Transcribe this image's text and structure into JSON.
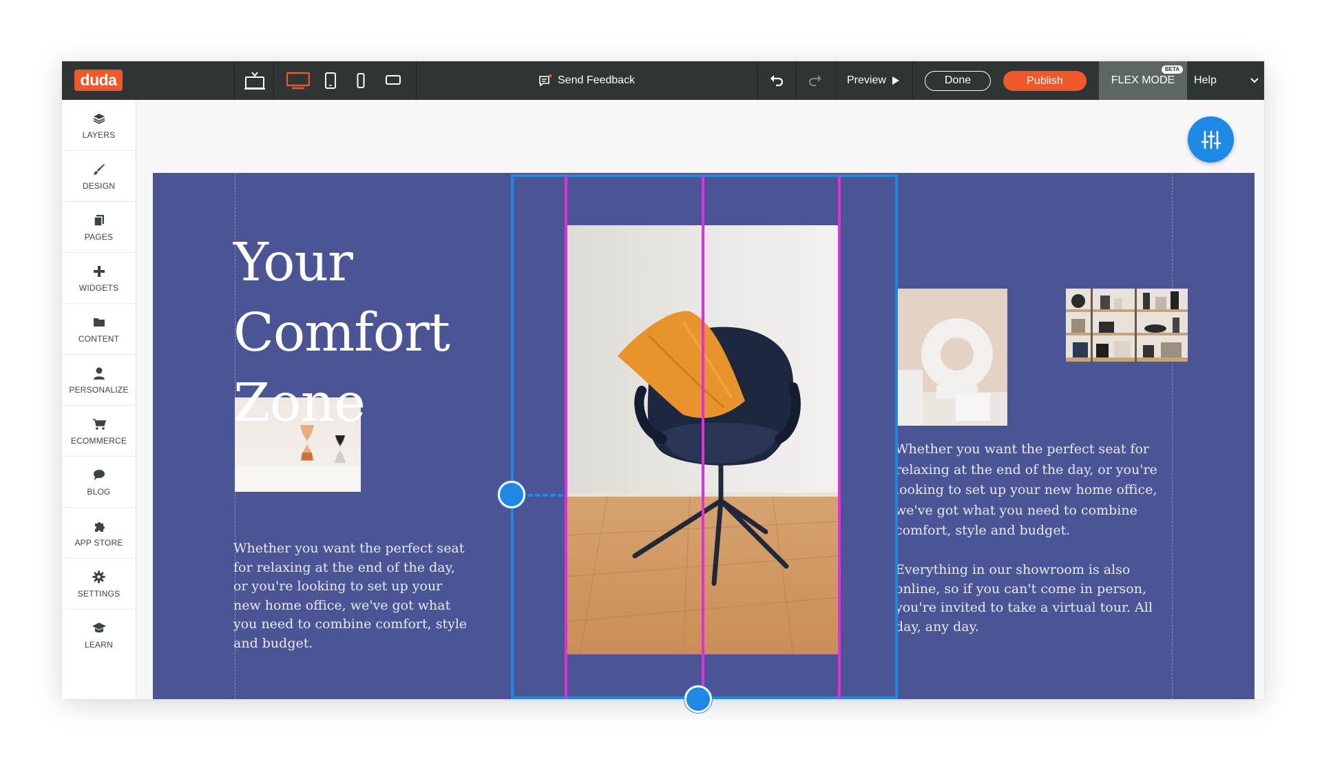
{
  "topbar": {
    "logo": "duda",
    "feedback_label": "Send Feedback",
    "preview_label": "Preview",
    "done_label": "Done",
    "publish_label": "Publish",
    "flex_mode_label": "FLEX MODE",
    "beta_label": "BETA",
    "help_label": "Help",
    "active_device": "desktop",
    "colors": {
      "bar": "#2f3435",
      "accent": "#f0582a",
      "flex": "#5d6566"
    }
  },
  "sidebar": {
    "items": [
      {
        "label": "LAYERS",
        "icon": "layers-icon"
      },
      {
        "label": "DESIGN",
        "icon": "brush-icon"
      },
      {
        "label": "PAGES",
        "icon": "pages-icon"
      },
      {
        "label": "WIDGETS",
        "icon": "plus-icon"
      },
      {
        "label": "CONTENT",
        "icon": "folder-icon"
      },
      {
        "label": "PERSONALIZE",
        "icon": "person-icon"
      },
      {
        "label": "ECOMMERCE",
        "icon": "cart-icon"
      },
      {
        "label": "BLOG",
        "icon": "speech-bubble-icon"
      },
      {
        "label": "APP STORE",
        "icon": "puzzle-icon"
      },
      {
        "label": "SETTINGS",
        "icon": "gear-icon"
      },
      {
        "label": "LEARN",
        "icon": "graduation-cap-icon"
      }
    ]
  },
  "canvas": {
    "section_color": "#4b5595",
    "selection_color": "#1e88e5",
    "guide_color": "#e22ee0",
    "hero_line_1": "Your",
    "hero_line_2": "Comfort",
    "hero_line_3": "Zone",
    "left_paragraph": "Whether you want the perfect seat for relaxing at the end of the day, or you're looking to set up your new home office, we've got what you need to combine comfort, style and budget.",
    "right_paragraph_1": "Whether you want the perfect seat for relaxing at the end of the day, or you're looking to set up your new home office, we've got what you need to combine comfort, style and budget.",
    "right_paragraph_2": "Everything in our showroom is also online, so if you can't come in person, you're invited to take a virtual tour. All day, any day."
  }
}
